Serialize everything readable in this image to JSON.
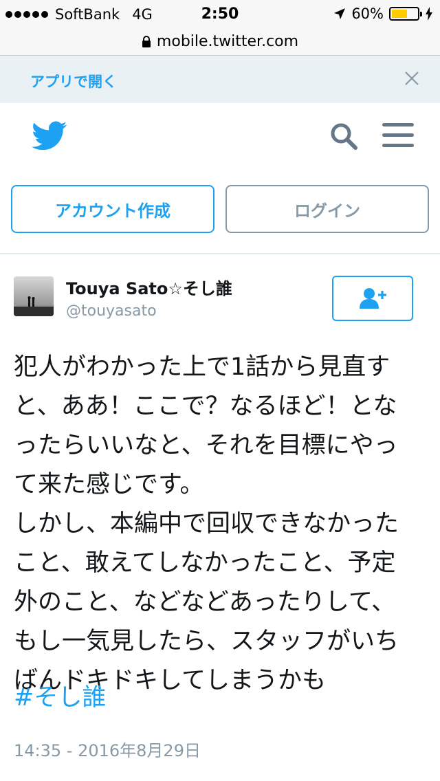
{
  "status_bar": {
    "carrier": "SoftBank",
    "network": "4G",
    "time": "2:50",
    "battery_text": "60%",
    "battery_level": 0.6
  },
  "url_bar": {
    "url": "mobile.twitter.com"
  },
  "banner": {
    "open_in_app": "アプリで開く"
  },
  "auth": {
    "signup_label": "アカウント作成",
    "login_label": "ログイン"
  },
  "tweet": {
    "display_name": "Touya Sato☆そし誰",
    "handle": "@touyasato",
    "lines": [
      "犯人がわかった上で1話から見直す",
      "と、ああ！ここで？なるほど！とな",
      "ったらいいなと、それを目標にやっ",
      "て来た感じです。",
      "しかし、本編中で回収できなかった",
      "こと、敢えてしなかったこと、予定",
      "外のこと、などなどあったりして、",
      "もし一気見したら、スタッフがいち",
      "ばんドキドキしてしまうかも"
    ],
    "hashtag": "#そし誰",
    "timestamp": "14:35 - 2016年8月29日"
  },
  "colors": {
    "accent": "#1da1f2",
    "muted": "#8899a6",
    "battery": "#ffcc00"
  },
  "icons": [
    "location-arrow-icon",
    "charging-icon",
    "lock-icon",
    "close-icon",
    "twitter-bird-icon",
    "search-icon",
    "menu-icon",
    "follow-user-icon"
  ]
}
